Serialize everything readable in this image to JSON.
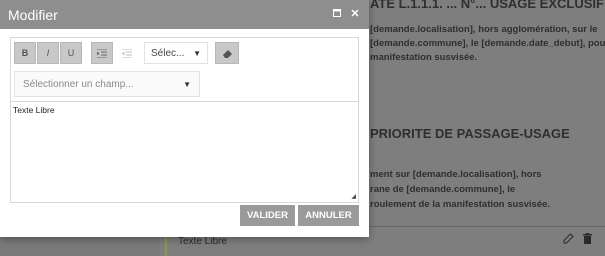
{
  "background": {
    "heading1": "ATE L.1.1.1. ... N°... USAGE EXCLUSIF",
    "para1": [
      "[demande.localisation], hors agglomération, sur le",
      "[demande.commune], le [demande.date_debut], pour",
      "manifestation susvisée."
    ],
    "heading2": "PRIORITE DE PASSAGE-USAGE",
    "para2": [
      "ment sur  [demande.localisation], hors",
      "rane de [demande.commune],  le",
      "roulement de la manifestation susvisée."
    ],
    "row_label": "Texte Libre",
    "row_icons": [
      "edit-icon",
      "trash-icon"
    ]
  },
  "modal": {
    "title": "Modifier",
    "controls": [
      "minimize-icon",
      "close-icon"
    ],
    "toolbar": {
      "bold": "B",
      "italic": "I",
      "underline": "U",
      "font_select": "Sélec...",
      "field_select_placeholder": "Sélectionner un champ..."
    },
    "content": "Texte Libre",
    "buttons": {
      "validate": "VALIDER",
      "cancel": "ANNULER"
    }
  }
}
